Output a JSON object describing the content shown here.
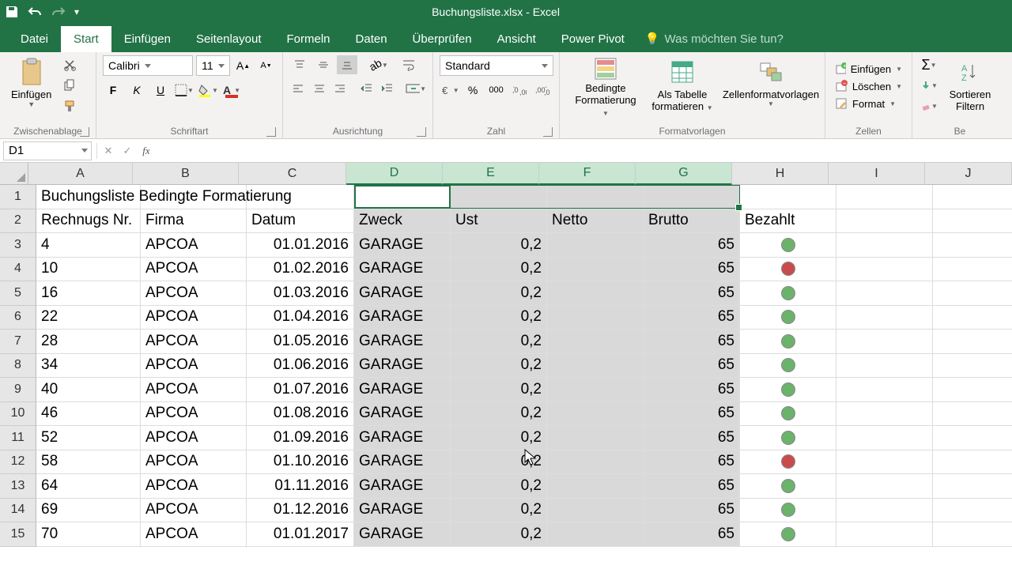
{
  "titlebar": {
    "title": "Buchungsliste.xlsx - Excel"
  },
  "tabs": {
    "items": [
      "Datei",
      "Start",
      "Einfügen",
      "Seitenlayout",
      "Formeln",
      "Daten",
      "Überprüfen",
      "Ansicht",
      "Power Pivot"
    ],
    "active_index": 1,
    "tell_me": "Was möchten Sie tun?"
  },
  "ribbon": {
    "clipboard": {
      "paste": "Einfügen",
      "group": "Zwischenablage"
    },
    "font": {
      "group": "Schriftart",
      "font_name": "Calibri",
      "font_size": "11",
      "bold": "F",
      "italic": "K",
      "underline": "U"
    },
    "alignment": {
      "group": "Ausrichtung"
    },
    "number": {
      "group": "Zahl",
      "format": "Standard"
    },
    "styles": {
      "group": "Formatvorlagen",
      "cond_format_l1": "Bedingte",
      "cond_format_l2": "Formatierung",
      "as_table_l1": "Als Tabelle",
      "as_table_l2": "formatieren",
      "cell_styles": "Zellenformatvorlagen"
    },
    "cells": {
      "group": "Zellen",
      "insert": "Einfügen",
      "delete": "Löschen",
      "format": "Format"
    },
    "editing": {
      "sort_l1": "Sortieren",
      "sort_l2": "Filtern",
      "group_truncated": "Be"
    }
  },
  "fbar": {
    "name_box": "D1"
  },
  "grid": {
    "columns": [
      {
        "letter": "A",
        "w": 132,
        "sel": false
      },
      {
        "letter": "B",
        "w": 134,
        "sel": false
      },
      {
        "letter": "C",
        "w": 136,
        "sel": false
      },
      {
        "letter": "D",
        "w": 122,
        "sel": true
      },
      {
        "letter": "E",
        "w": 122,
        "sel": true
      },
      {
        "letter": "F",
        "w": 122,
        "sel": true
      },
      {
        "letter": "G",
        "w": 122,
        "sel": true
      },
      {
        "letter": "H",
        "w": 122,
        "sel": false
      },
      {
        "letter": "I",
        "w": 122,
        "sel": false
      },
      {
        "letter": "J",
        "w": 110,
        "sel": false
      }
    ],
    "title_row": "Buchungsliste Bedingte Formatierung",
    "headers": {
      "a": "Rechnugs Nr.",
      "b": "Firma",
      "c": "Datum",
      "d": "Zweck",
      "e": "Ust",
      "f": "Netto",
      "g": "Brutto",
      "h": "Bezahlt"
    },
    "rows": [
      {
        "nr": "4",
        "firma": "APCOA",
        "datum": "01.01.2016",
        "zweck": "GARAGE",
        "ust": "0,2",
        "brutto": "65",
        "status": "green"
      },
      {
        "nr": "10",
        "firma": "APCOA",
        "datum": "01.02.2016",
        "zweck": "GARAGE",
        "ust": "0,2",
        "brutto": "65",
        "status": "red"
      },
      {
        "nr": "16",
        "firma": "APCOA",
        "datum": "01.03.2016",
        "zweck": "GARAGE",
        "ust": "0,2",
        "brutto": "65",
        "status": "green"
      },
      {
        "nr": "22",
        "firma": "APCOA",
        "datum": "01.04.2016",
        "zweck": "GARAGE",
        "ust": "0,2",
        "brutto": "65",
        "status": "green"
      },
      {
        "nr": "28",
        "firma": "APCOA",
        "datum": "01.05.2016",
        "zweck": "GARAGE",
        "ust": "0,2",
        "brutto": "65",
        "status": "green"
      },
      {
        "nr": "34",
        "firma": "APCOA",
        "datum": "01.06.2016",
        "zweck": "GARAGE",
        "ust": "0,2",
        "brutto": "65",
        "status": "green"
      },
      {
        "nr": "40",
        "firma": "APCOA",
        "datum": "01.07.2016",
        "zweck": "GARAGE",
        "ust": "0,2",
        "brutto": "65",
        "status": "green"
      },
      {
        "nr": "46",
        "firma": "APCOA",
        "datum": "01.08.2016",
        "zweck": "GARAGE",
        "ust": "0,2",
        "brutto": "65",
        "status": "green"
      },
      {
        "nr": "52",
        "firma": "APCOA",
        "datum": "01.09.2016",
        "zweck": "GARAGE",
        "ust": "0,2",
        "brutto": "65",
        "status": "green"
      },
      {
        "nr": "58",
        "firma": "APCOA",
        "datum": "01.10.2016",
        "zweck": "GARAGE",
        "ust": "0,2",
        "brutto": "65",
        "status": "red"
      },
      {
        "nr": "64",
        "firma": "APCOA",
        "datum": "01.11.2016",
        "zweck": "GARAGE",
        "ust": "0,2",
        "brutto": "65",
        "status": "green"
      },
      {
        "nr": "69",
        "firma": "APCOA",
        "datum": "01.12.2016",
        "zweck": "GARAGE",
        "ust": "0,2",
        "brutto": "65",
        "status": "green"
      },
      {
        "nr": "70",
        "firma": "APCOA",
        "datum": "01.01.2017",
        "zweck": "GARAGE",
        "ust": "0,2",
        "brutto": "65",
        "status": "green"
      }
    ]
  },
  "colors": {
    "accent": "#217346"
  }
}
